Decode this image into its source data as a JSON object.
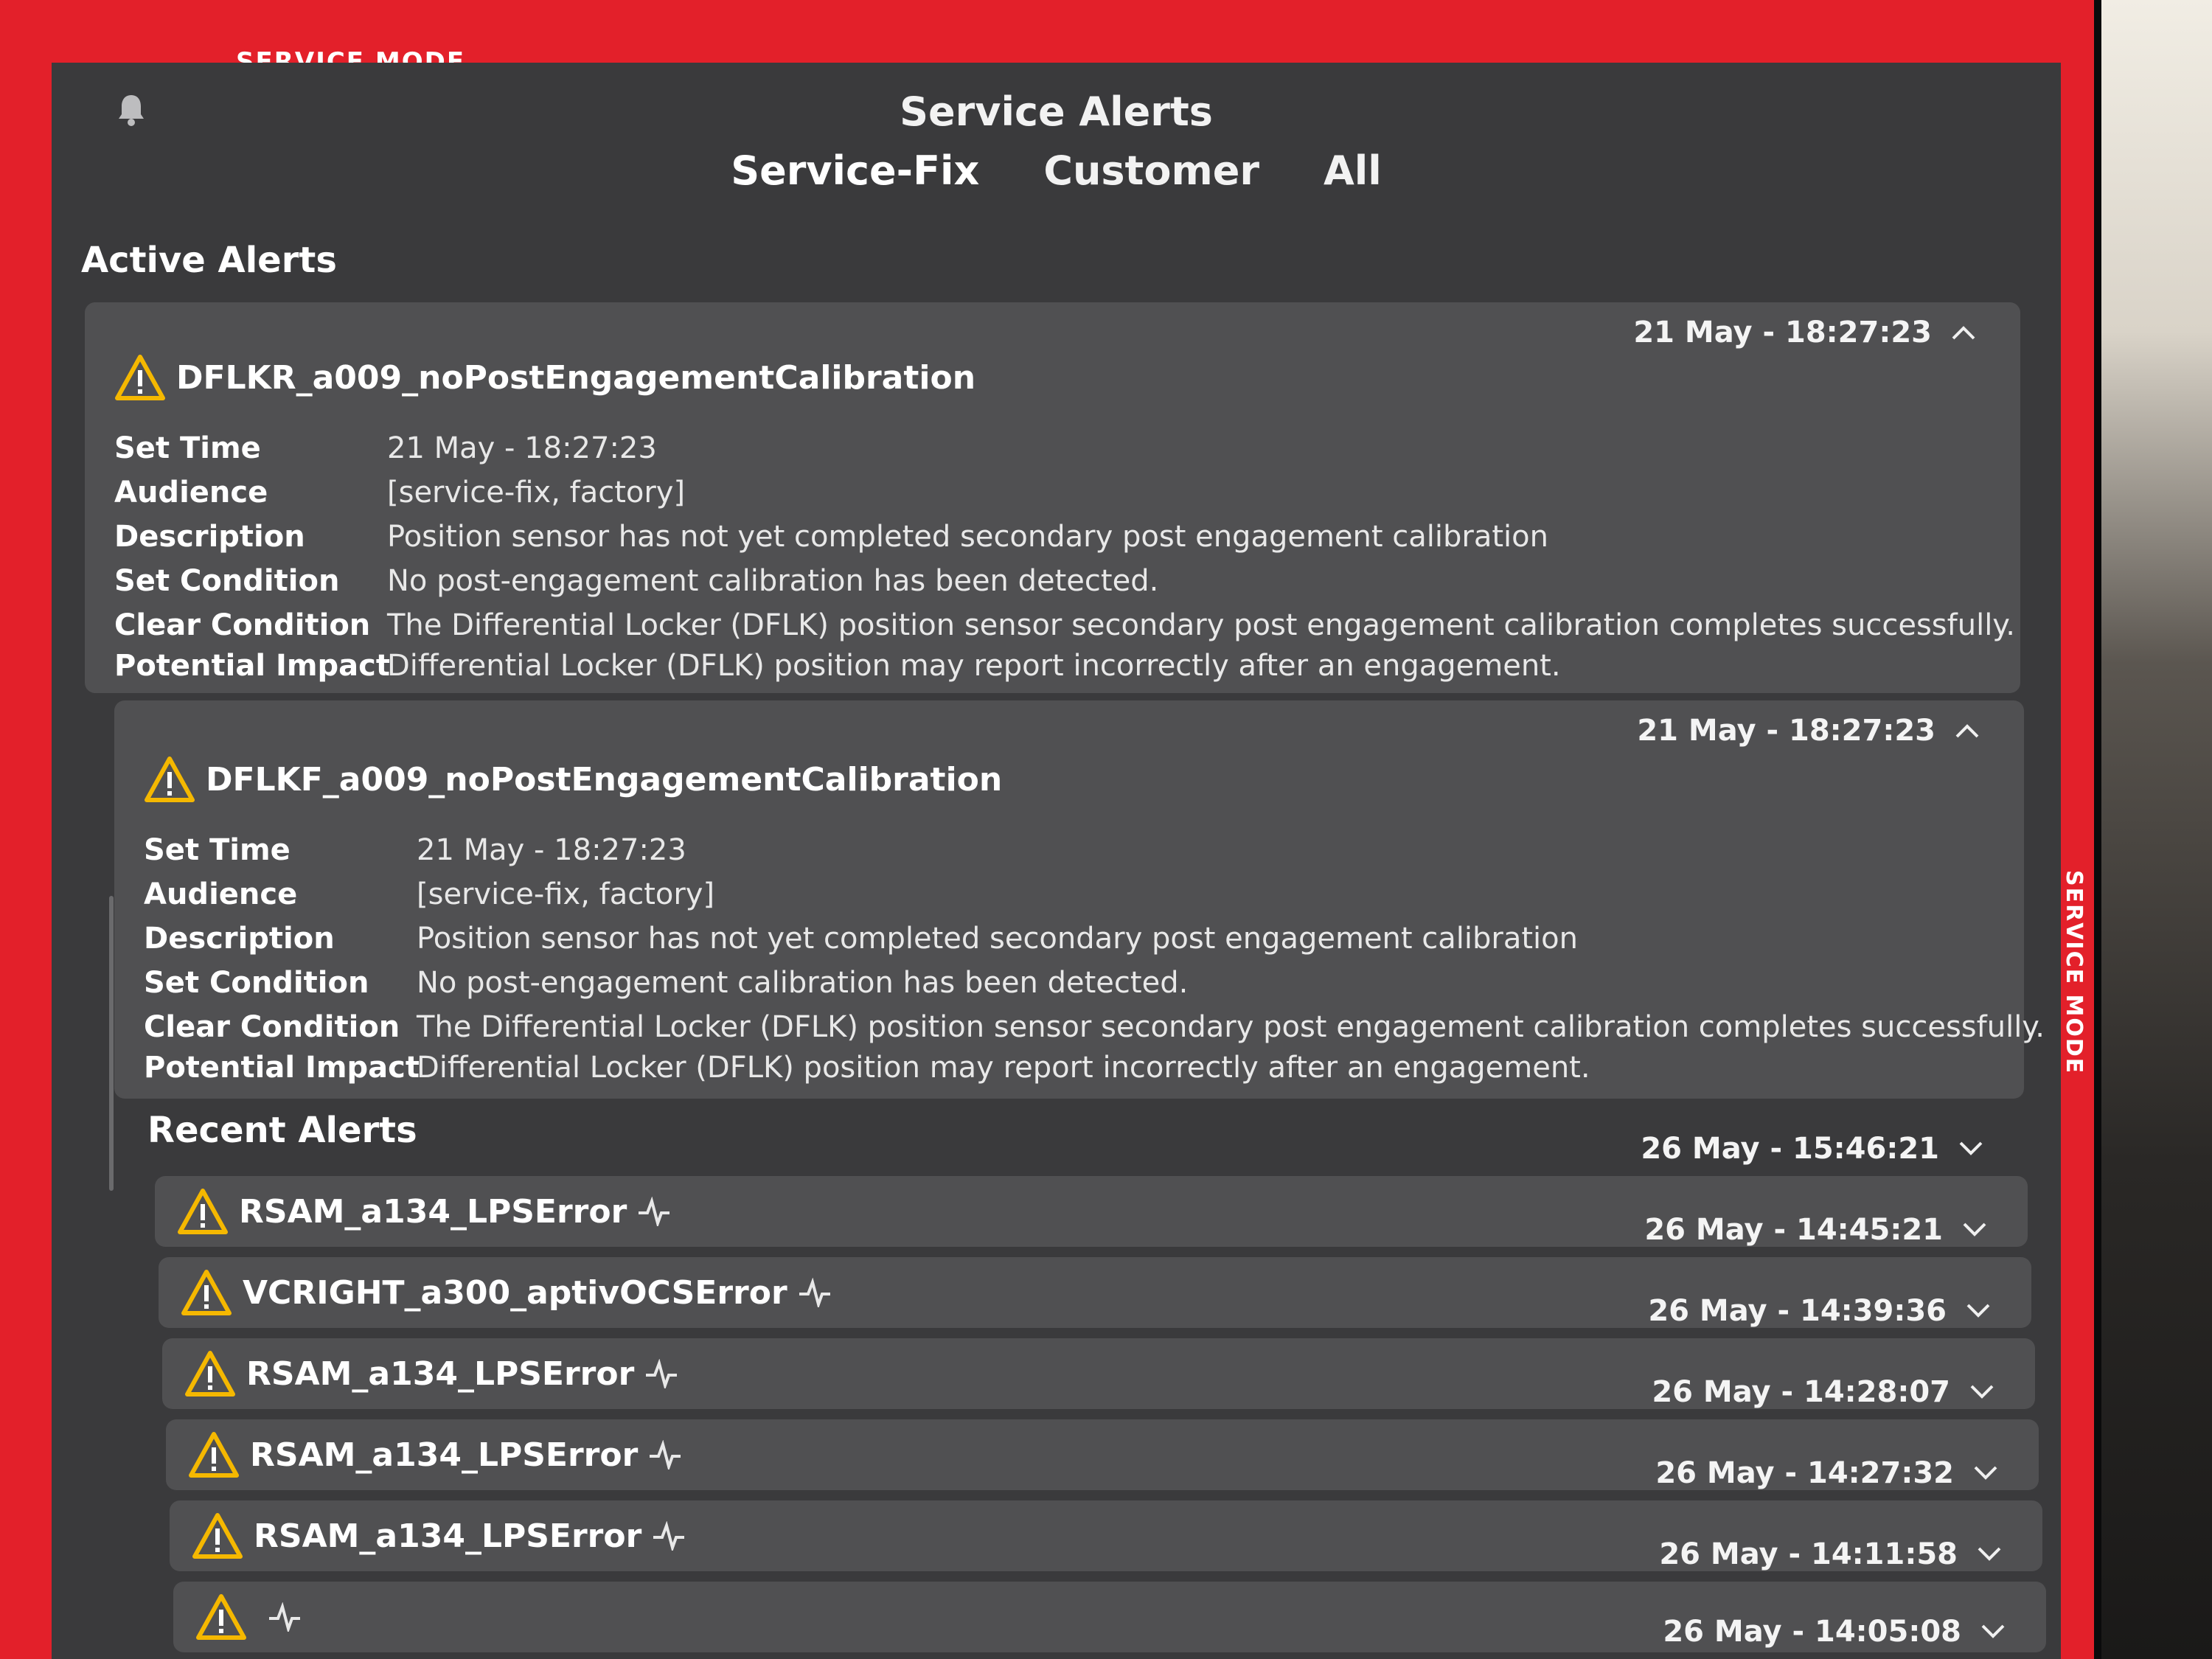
{
  "banner": {
    "service_mode": "SERVICE MODE",
    "service_mode_side": "SERVICE MODE"
  },
  "header": {
    "title": "Service Alerts",
    "tabs": [
      {
        "label": "Service-Fix",
        "active": true
      },
      {
        "label": "Customer",
        "active": false
      },
      {
        "label": "All",
        "active": false
      }
    ]
  },
  "active": {
    "heading": "Active Alerts",
    "alerts": [
      {
        "name": "DFLKR_a009_noPostEngagementCalibration",
        "timestamp": "21 May - 18:27:23",
        "fields": [
          {
            "k": "Set Time",
            "v": "21 May - 18:27:23"
          },
          {
            "k": "Audience",
            "v": "[service-fix, factory]"
          },
          {
            "k": "Description",
            "v": "Position sensor has not yet completed secondary post engagement calibration"
          },
          {
            "k": "Set Condition",
            "v": "No post-engagement calibration has been detected."
          },
          {
            "k": "Clear Condition",
            "v": "The Differential Locker (DFLK) position sensor secondary post engagement calibration completes successfully."
          },
          {
            "k": "Potential Impact",
            "v": "Differential Locker (DFLK) position may report incorrectly after an engagement."
          }
        ]
      },
      {
        "name": "DFLKF_a009_noPostEngagementCalibration",
        "timestamp": "21 May - 18:27:23",
        "fields": [
          {
            "k": "Set Time",
            "v": "21 May - 18:27:23"
          },
          {
            "k": "Audience",
            "v": "[service-fix, factory]"
          },
          {
            "k": "Description",
            "v": "Position sensor has not yet completed secondary post engagement calibration"
          },
          {
            "k": "Set Condition",
            "v": "No post-engagement calibration has been detected."
          },
          {
            "k": "Clear Condition",
            "v": "The Differential Locker (DFLK) position sensor secondary post engagement calibration completes successfully."
          },
          {
            "k": "Potential Impact",
            "v": "Differential Locker (DFLK) position may report incorrectly after an engagement."
          }
        ]
      }
    ]
  },
  "recent": {
    "heading": "Recent Alerts",
    "alerts": [
      {
        "name": "RSAM_a134_LPSError",
        "timestamp": "26 May - 15:46:21"
      },
      {
        "name": "VCRIGHT_a300_aptivOCSError",
        "timestamp": "26 May - 14:45:21"
      },
      {
        "name": "RSAM_a134_LPSError",
        "timestamp": "26 May - 14:39:36"
      },
      {
        "name": "RSAM_a134_LPSError",
        "timestamp": "26 May - 14:28:07"
      },
      {
        "name": "RSAM_a134_LPSError",
        "timestamp": "26 May - 14:27:32"
      },
      {
        "name": "",
        "timestamp": "26 May - 14:11:58"
      },
      {
        "name": "",
        "timestamp": "26 May - 14:05:08"
      }
    ]
  },
  "colors": {
    "service_red": "#e3202a",
    "warn_yellow": "#f5b800",
    "panel": "#3a3a3c",
    "card": "#505052"
  }
}
